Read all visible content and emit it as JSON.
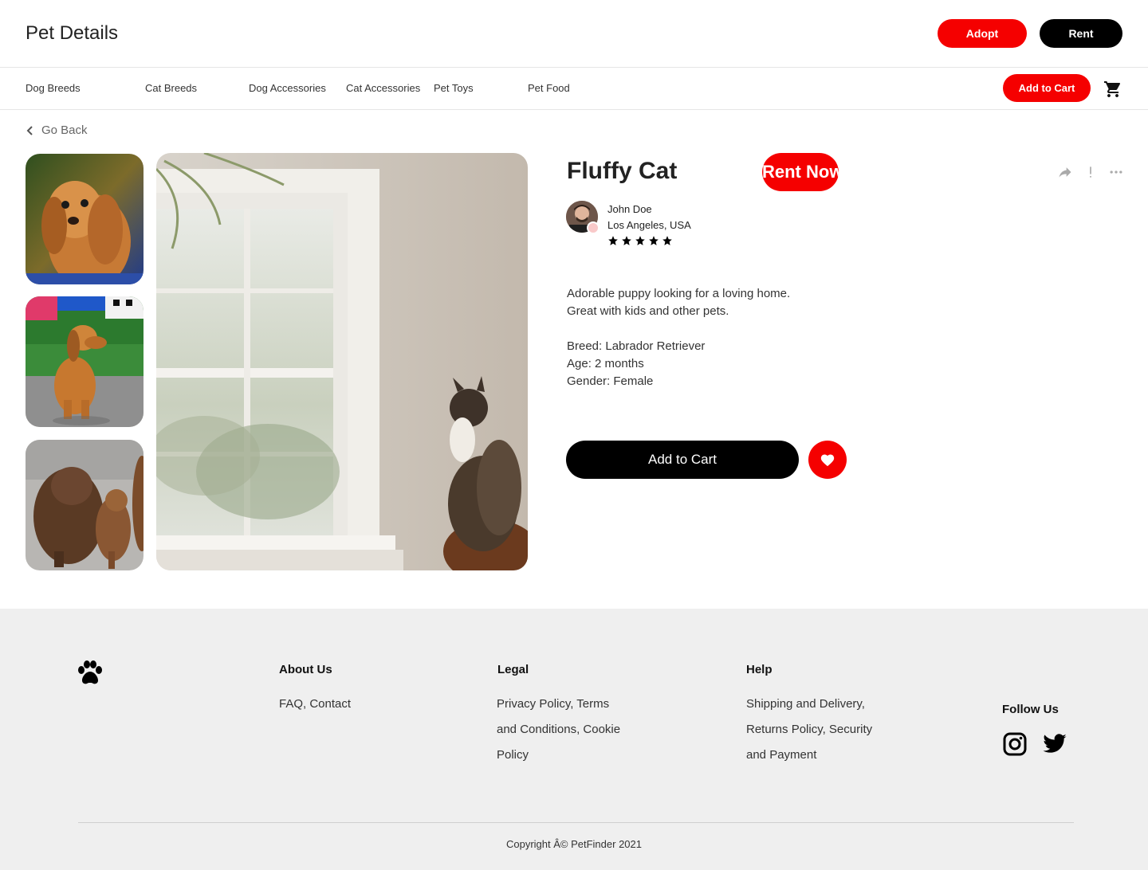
{
  "header": {
    "title": "Pet Details",
    "adopt_label": "Adopt",
    "rent_label": "Rent"
  },
  "nav": {
    "links": [
      "Dog Breeds",
      "Cat Breeds",
      "Dog Accessories",
      "Cat Accessories",
      "Pet Toys",
      "Pet Food"
    ],
    "add_to_cart_label": "Add to Cart",
    "cart_icon": "shopping-cart-icon"
  },
  "go_back": "Go Back",
  "gallery": {
    "thumbnails": [
      "cocker spaniel puppy",
      "dachshund sitting",
      "two fluffy brown dogs"
    ],
    "main": "cat on sofa by window"
  },
  "pet": {
    "name": "Fluffy Cat",
    "rent_now_label": "Rent Now",
    "owner": {
      "name": "John Doe",
      "location": "Los Angeles, USA",
      "rating": 5,
      "rating_max": 5
    },
    "description_line1": "Adorable puppy looking for a loving home.",
    "description_line2": "Great with kids and other pets.",
    "breed": "Breed: Labrador Retriever",
    "age": "Age: 2 months",
    "gender": "Gender: Female",
    "add_to_cart_label": "Add to Cart"
  },
  "footer": {
    "about_heading": "About Us",
    "about_links": "FAQ, Contact",
    "legal_heading": "Legal",
    "legal_line1": "Privacy Policy, Terms",
    "legal_line2": "and Conditions, Cookie",
    "legal_line3": "Policy",
    "help_heading": "Help",
    "help_line1": "Shipping and Delivery,",
    "help_line2": "Returns Policy, Security",
    "help_line3": "and Payment",
    "follow_heading": "Follow Us",
    "social": [
      "instagram-icon",
      "twitter-icon"
    ],
    "copyright": "Copyright Â© PetFinder 2021"
  },
  "colors": {
    "accent": "#f50000",
    "dark": "#000000",
    "footer_bg": "#efefef"
  }
}
